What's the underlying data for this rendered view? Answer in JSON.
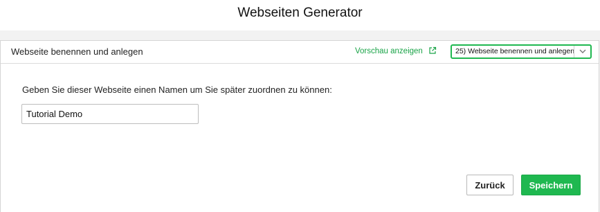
{
  "page": {
    "title": "Webseiten Generator"
  },
  "panel": {
    "title": "Webseite benennen und anlegen",
    "preview_link": "Vorschau anzeigen",
    "preview_icon": "external-link-icon",
    "step_select": {
      "selected": "25) Webseite benennen und anlegen",
      "icon": "chevron-down-icon"
    }
  },
  "form": {
    "prompt": "Geben Sie dieser Webseite einen Namen um Sie später zuordnen zu können:",
    "name_value": "Tutorial Demo",
    "name_placeholder": ""
  },
  "actions": {
    "back_label": "Zurück",
    "save_label": "Speichern"
  },
  "colors": {
    "accent": "#1fb850",
    "link": "#19a347",
    "background": "#f2f2f2"
  }
}
